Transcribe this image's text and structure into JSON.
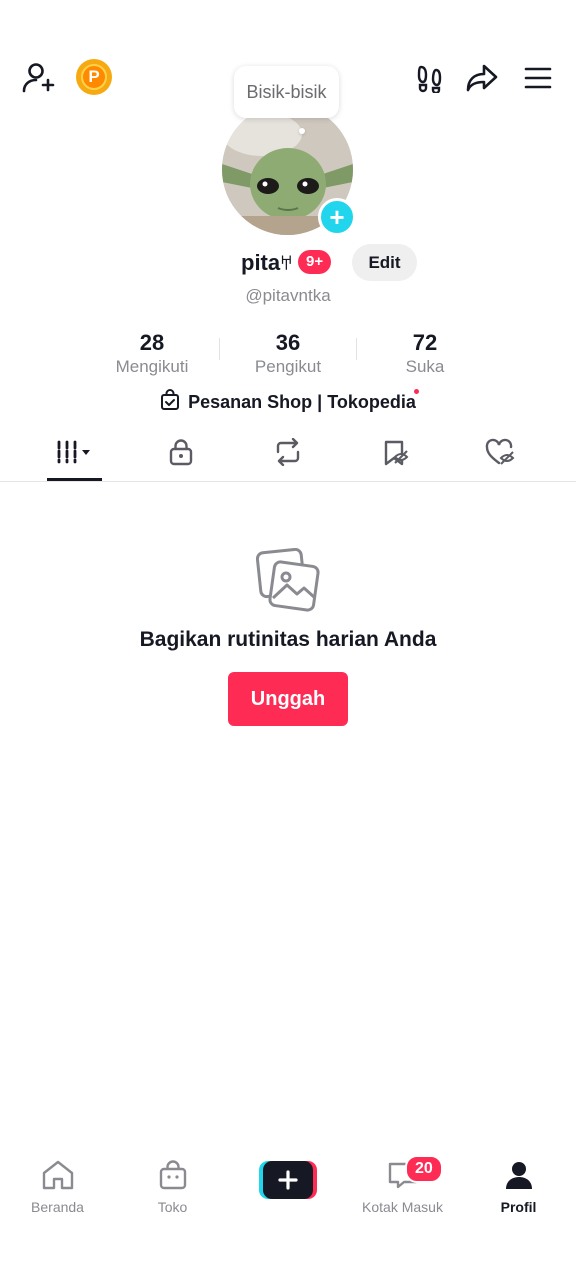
{
  "top_bar": {
    "points_label": "P",
    "tooltip": "Bisik-bisik"
  },
  "profile": {
    "username": "pita",
    "username_glyph": "𐀀",
    "notif_badge": "9+",
    "edit_label": "Edit",
    "handle": "@pitavntka"
  },
  "stats": [
    {
      "value": "28",
      "label": "Mengikuti"
    },
    {
      "value": "36",
      "label": "Pengikut"
    },
    {
      "value": "72",
      "label": "Suka"
    }
  ],
  "shop_link": "Pesanan Shop | Tokopedia",
  "empty_state": {
    "title": "Bagikan rutinitas harian Anda",
    "button": "Unggah"
  },
  "nav": {
    "items": [
      {
        "label": "Beranda",
        "icon": "home-icon"
      },
      {
        "label": "Toko",
        "icon": "shop-bag-icon"
      },
      {
        "label": "",
        "icon": "plus-icon"
      },
      {
        "label": "Kotak Masuk",
        "icon": "inbox-icon"
      },
      {
        "label": "Profil",
        "icon": "profile-icon"
      }
    ],
    "inbox_badge": "20"
  },
  "colors": {
    "accent": "#fe2c55",
    "cyan": "#20d5ec",
    "text": "#161823",
    "muted": "#8a8b91"
  }
}
